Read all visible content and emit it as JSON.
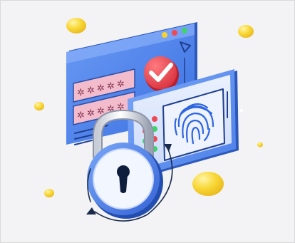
{
  "illustration": {
    "subject": "security-illustration",
    "icons": [
      "browser-window",
      "password-field",
      "checkmark-badge",
      "phone",
      "fingerprint",
      "padlock",
      "keyhole"
    ],
    "colors": {
      "background": "#f3f3f5",
      "window_blue": "#4d82ec",
      "window_shade": "#3462c8",
      "panel": "#dbe6fb",
      "field_pink": "#f1b3c6",
      "check_red": "#e9434d",
      "coin_yellow": "#f6d32c",
      "dot_green": "#3fd36c"
    }
  }
}
